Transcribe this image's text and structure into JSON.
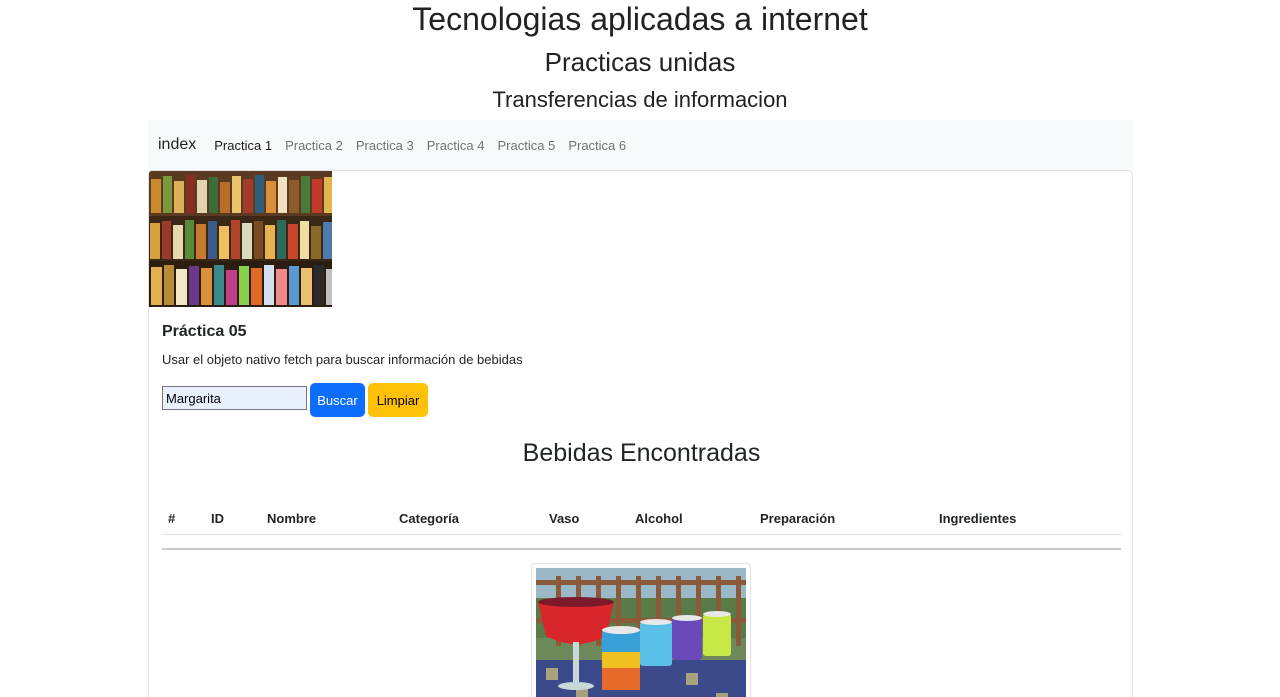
{
  "header": {
    "title": "Tecnologias aplicadas a internet",
    "subtitle": "Practicas unidas",
    "tagline": "Transferencias de informacion"
  },
  "navbar": {
    "brand": "index",
    "links": [
      {
        "label": "Practica 1",
        "active": true
      },
      {
        "label": "Practica 2",
        "active": false
      },
      {
        "label": "Practica 3",
        "active": false
      },
      {
        "label": "Practica 4",
        "active": false
      },
      {
        "label": "Practica 5",
        "active": false
      },
      {
        "label": "Practica 6",
        "active": false
      }
    ]
  },
  "card": {
    "title": "Práctica 05",
    "description": "Usar el objeto nativo fetch para buscar información de bebidas",
    "search": {
      "value": "Margarita"
    },
    "buttons": {
      "search": "Buscar",
      "clear": "Limpiar"
    },
    "results_title": "Bebidas Encontradas",
    "table": {
      "headers": [
        "#",
        "ID",
        "Nombre",
        "Categoría",
        "Vaso",
        "Alcohol",
        "Preparación",
        "Ingredientes"
      ]
    }
  },
  "colors": {
    "primary": "#0d6efd",
    "warning": "#ffc107",
    "navbar_bg": "#f8f9fa"
  }
}
